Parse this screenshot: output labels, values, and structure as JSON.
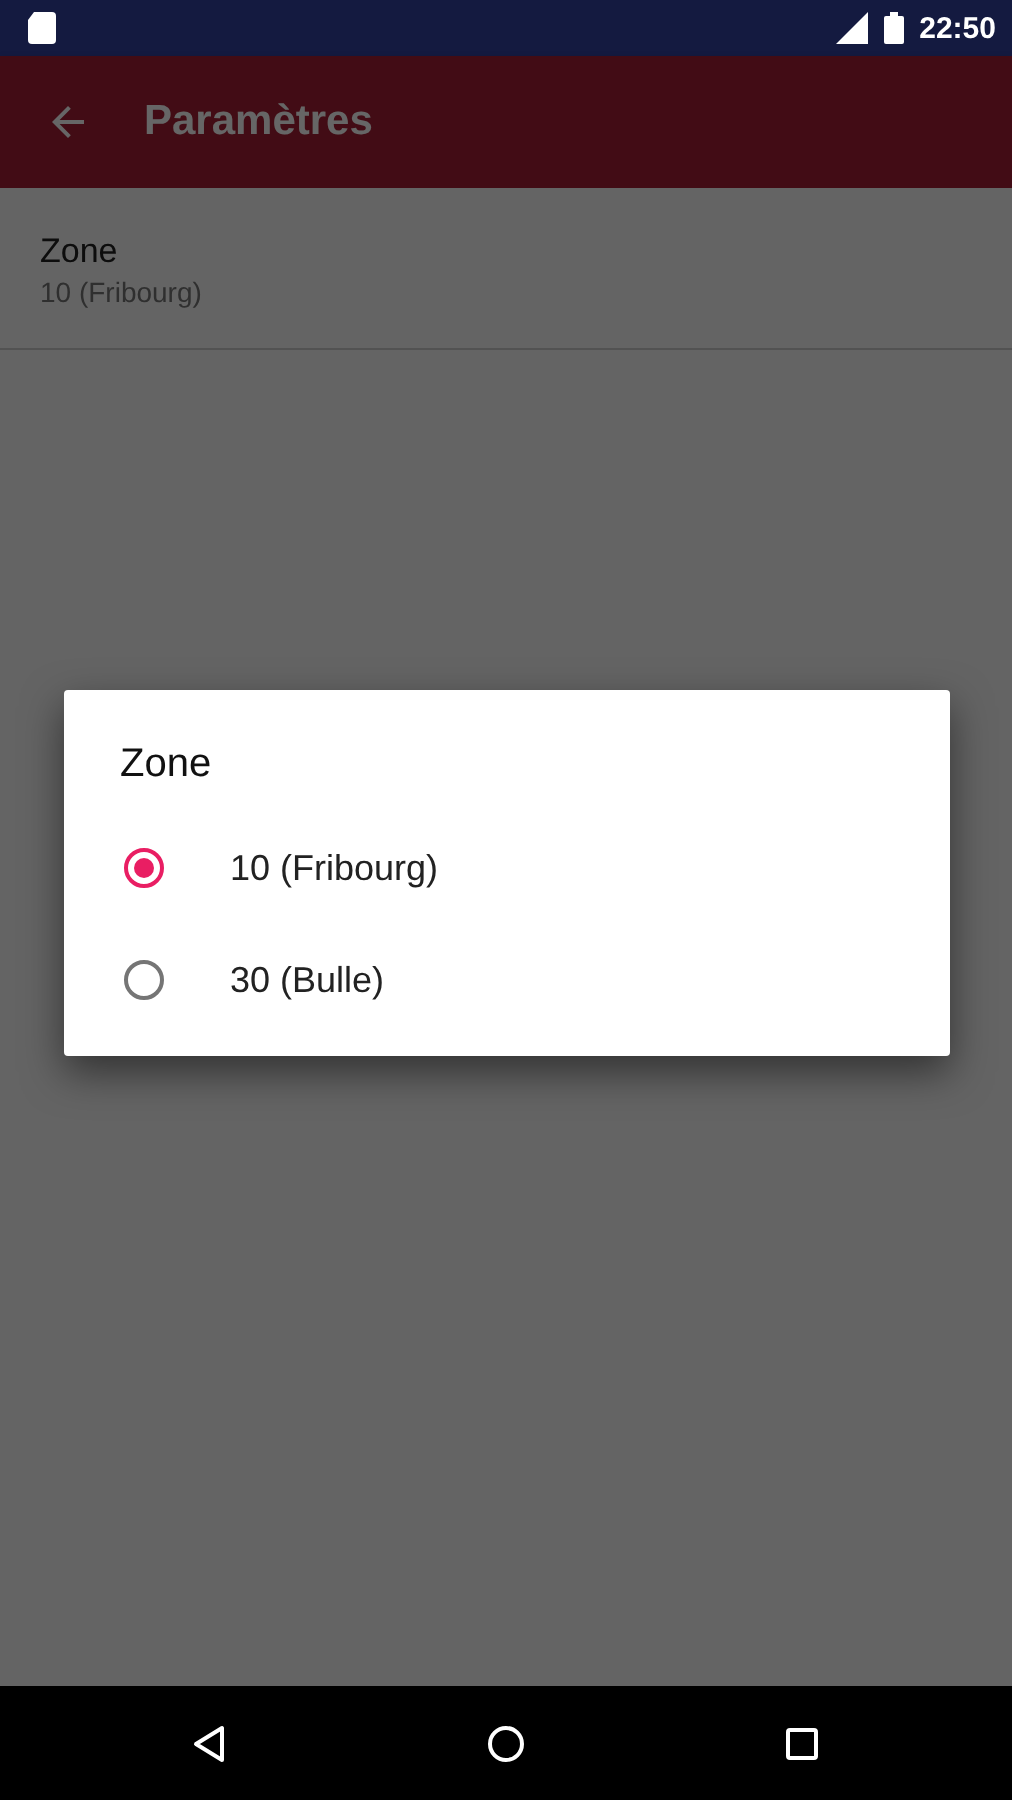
{
  "status_bar": {
    "time": "22:50"
  },
  "app_bar": {
    "title": "Paramètres"
  },
  "preferences": [
    {
      "title": "Zone",
      "summary": "10 (Fribourg)"
    }
  ],
  "dialog": {
    "title": "Zone",
    "options": [
      {
        "label": "10 (Fribourg)",
        "selected": true
      },
      {
        "label": "30 (Bulle)",
        "selected": false
      }
    ]
  }
}
